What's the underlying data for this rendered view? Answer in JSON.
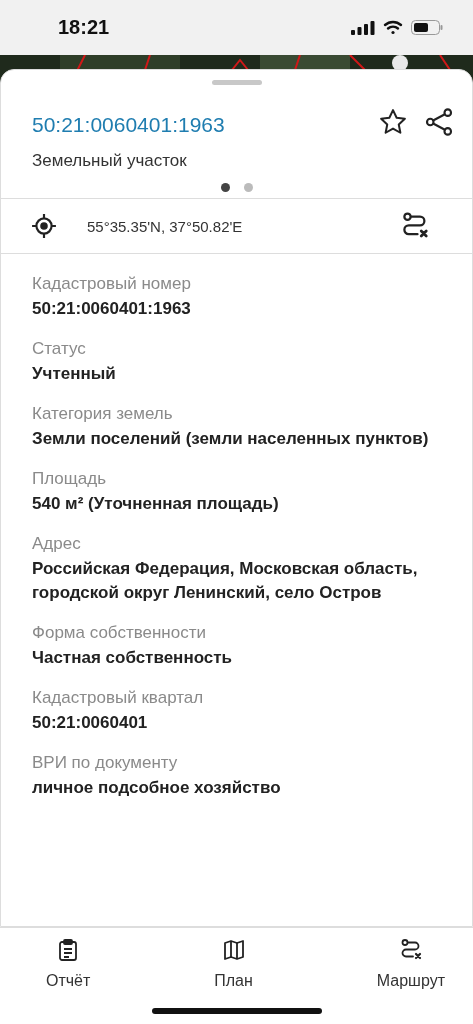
{
  "status_bar": {
    "time": "18:21"
  },
  "card": {
    "title": "50:21:0060401:1963",
    "subtitle": "Земельный участок",
    "pages": [
      {
        "selected": true
      },
      {
        "selected": false
      }
    ],
    "coordinates": "55°35.35'N, 37°50.82'E"
  },
  "fields": [
    {
      "label": "Кадастровый номер",
      "value": "50:21:0060401:1963"
    },
    {
      "label": "Статус",
      "value": "Учтенный"
    },
    {
      "label": "Категория земель",
      "value": "Земли поселений (земли населенных пунктов)"
    },
    {
      "label": "Площадь",
      "value": "540 м² (Уточненная площадь)"
    },
    {
      "label": "Адрес",
      "value": "Российская Федерация, Московская область, городской округ Ленинский, село Остров"
    },
    {
      "label": "Форма собственности",
      "value": "Частная собственность"
    },
    {
      "label": "Кадастровый квартал",
      "value": "50:21:0060401"
    },
    {
      "label": "ВРИ по документу",
      "value": "личное подсобное хозяйство"
    }
  ],
  "bottom_bar": [
    {
      "kind": "report",
      "label": "Отчёт"
    },
    {
      "kind": "map",
      "label": "План"
    },
    {
      "kind": "route",
      "label": "Маршрут"
    }
  ]
}
